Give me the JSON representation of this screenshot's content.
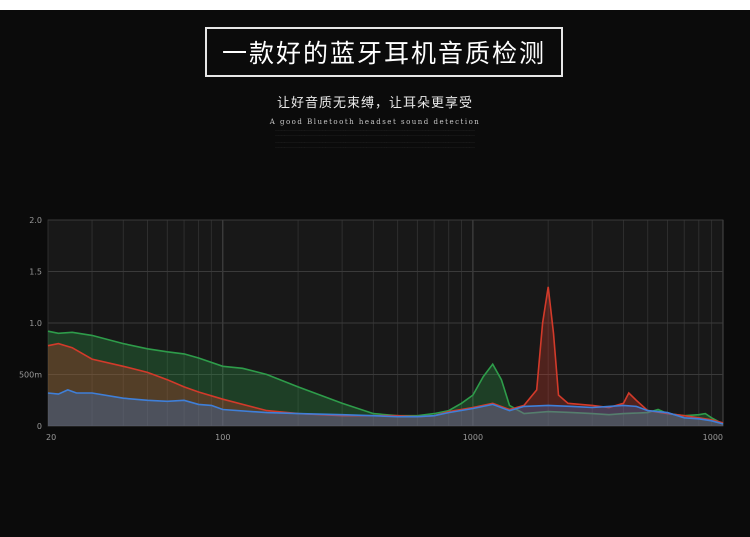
{
  "header": {
    "title": "一款好的蓝牙耳机音质检测",
    "subtitle": "让好音质无束缚，让耳朵更享受",
    "english": "A good Bluetooth headset sound detection"
  },
  "chart_data": {
    "type": "area",
    "x_scale": "log",
    "xlim": [
      20,
      10000
    ],
    "ylim": [
      0,
      2.0
    ],
    "x_ticks": [
      {
        "value": 20,
        "label": "20"
      },
      {
        "value": 100,
        "label": "100"
      },
      {
        "value": 1000,
        "label": "1000"
      },
      {
        "value": 10000,
        "label": "1000"
      }
    ],
    "y_ticks": [
      {
        "value": 0,
        "label": "0"
      },
      {
        "value": 0.5,
        "label": "500m"
      },
      {
        "value": 1.0,
        "label": "1.0"
      },
      {
        "value": 1.5,
        "label": "1.5"
      },
      {
        "value": 2.0,
        "label": "2.0"
      }
    ],
    "grid": true,
    "legend": "none",
    "series": [
      {
        "color": "#2e9c4a",
        "points": [
          [
            20,
            0.92
          ],
          [
            22,
            0.9
          ],
          [
            25,
            0.91
          ],
          [
            30,
            0.88
          ],
          [
            40,
            0.8
          ],
          [
            50,
            0.75
          ],
          [
            60,
            0.72
          ],
          [
            70,
            0.7
          ],
          [
            80,
            0.66
          ],
          [
            100,
            0.58
          ],
          [
            120,
            0.56
          ],
          [
            150,
            0.5
          ],
          [
            200,
            0.38
          ],
          [
            300,
            0.22
          ],
          [
            400,
            0.12
          ],
          [
            500,
            0.1
          ],
          [
            600,
            0.1
          ],
          [
            700,
            0.12
          ],
          [
            800,
            0.15
          ],
          [
            900,
            0.22
          ],
          [
            1000,
            0.3
          ],
          [
            1100,
            0.48
          ],
          [
            1200,
            0.6
          ],
          [
            1300,
            0.45
          ],
          [
            1400,
            0.2
          ],
          [
            1600,
            0.12
          ],
          [
            2000,
            0.14
          ],
          [
            2500,
            0.13
          ],
          [
            3000,
            0.12
          ],
          [
            3500,
            0.11
          ],
          [
            4000,
            0.12
          ],
          [
            5000,
            0.13
          ],
          [
            5500,
            0.16
          ],
          [
            6000,
            0.12
          ],
          [
            7000,
            0.1
          ],
          [
            8000,
            0.11
          ],
          [
            8500,
            0.12
          ],
          [
            9000,
            0.08
          ],
          [
            10000,
            0.02
          ]
        ]
      },
      {
        "color": "#d23a2a",
        "points": [
          [
            20,
            0.78
          ],
          [
            22,
            0.8
          ],
          [
            25,
            0.76
          ],
          [
            30,
            0.65
          ],
          [
            40,
            0.58
          ],
          [
            50,
            0.52
          ],
          [
            60,
            0.45
          ],
          [
            70,
            0.38
          ],
          [
            80,
            0.33
          ],
          [
            100,
            0.26
          ],
          [
            150,
            0.15
          ],
          [
            200,
            0.12
          ],
          [
            300,
            0.1
          ],
          [
            400,
            0.1
          ],
          [
            500,
            0.1
          ],
          [
            600,
            0.09
          ],
          [
            700,
            0.1
          ],
          [
            800,
            0.14
          ],
          [
            1000,
            0.18
          ],
          [
            1200,
            0.22
          ],
          [
            1400,
            0.16
          ],
          [
            1600,
            0.2
          ],
          [
            1800,
            0.35
          ],
          [
            1900,
            1.0
          ],
          [
            2000,
            1.35
          ],
          [
            2100,
            0.9
          ],
          [
            2200,
            0.3
          ],
          [
            2400,
            0.22
          ],
          [
            3000,
            0.2
          ],
          [
            3500,
            0.18
          ],
          [
            4000,
            0.22
          ],
          [
            4200,
            0.32
          ],
          [
            4500,
            0.25
          ],
          [
            5000,
            0.15
          ],
          [
            6000,
            0.12
          ],
          [
            7000,
            0.1
          ],
          [
            8000,
            0.08
          ],
          [
            9000,
            0.06
          ],
          [
            10000,
            0.03
          ]
        ]
      },
      {
        "color": "#3f7fd8",
        "points": [
          [
            20,
            0.32
          ],
          [
            22,
            0.31
          ],
          [
            24,
            0.35
          ],
          [
            26,
            0.32
          ],
          [
            30,
            0.32
          ],
          [
            40,
            0.27
          ],
          [
            50,
            0.25
          ],
          [
            60,
            0.24
          ],
          [
            70,
            0.25
          ],
          [
            80,
            0.21
          ],
          [
            90,
            0.2
          ],
          [
            100,
            0.16
          ],
          [
            150,
            0.13
          ],
          [
            200,
            0.12
          ],
          [
            300,
            0.11
          ],
          [
            400,
            0.1
          ],
          [
            500,
            0.09
          ],
          [
            600,
            0.09
          ],
          [
            700,
            0.1
          ],
          [
            800,
            0.13
          ],
          [
            1000,
            0.17
          ],
          [
            1200,
            0.21
          ],
          [
            1400,
            0.15
          ],
          [
            1600,
            0.19
          ],
          [
            2000,
            0.2
          ],
          [
            2500,
            0.19
          ],
          [
            3000,
            0.18
          ],
          [
            3500,
            0.19
          ],
          [
            4000,
            0.2
          ],
          [
            4500,
            0.19
          ],
          [
            5000,
            0.15
          ],
          [
            6000,
            0.13
          ],
          [
            7000,
            0.08
          ],
          [
            8000,
            0.07
          ],
          [
            9000,
            0.05
          ],
          [
            10000,
            0.02
          ]
        ]
      }
    ]
  }
}
